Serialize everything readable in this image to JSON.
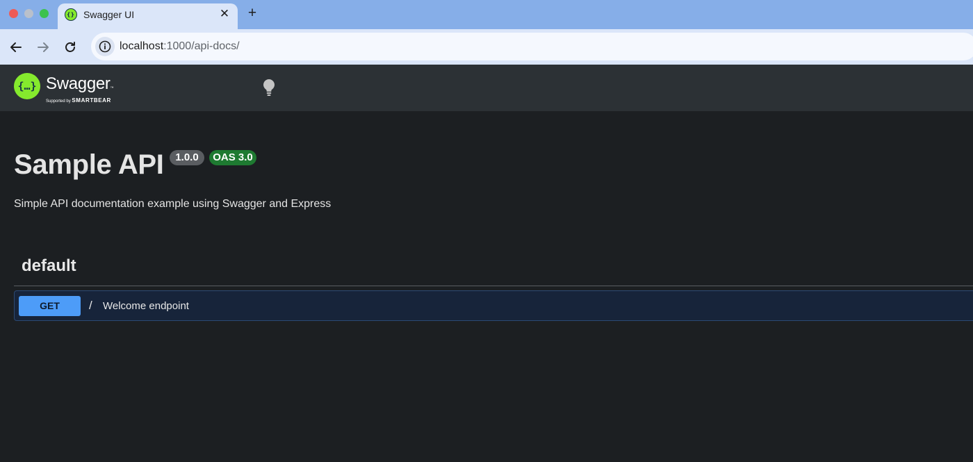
{
  "browser": {
    "tab": {
      "title": "Swagger UI"
    },
    "url": {
      "host": "localhost",
      "path": ":1000/api-docs/"
    }
  },
  "topbar": {
    "logo_text": "Swagger",
    "logo_tm": "™",
    "logo_supported_by": "Supported by",
    "logo_company": "SMARTBEAR"
  },
  "info": {
    "title": "Sample API",
    "version": "1.0.0",
    "oas_version": "OAS 3.0",
    "description": "Simple API documentation example using Swagger and Express"
  },
  "tags": [
    {
      "name": "default",
      "operations": [
        {
          "method": "GET",
          "path": "/",
          "summary": "Welcome endpoint"
        }
      ]
    }
  ],
  "colors": {
    "get_method": "#4d9cf8",
    "get_block_bg": "#17243a",
    "oas_badge": "#1e7a31",
    "version_badge": "#5a5d61",
    "swagger_green": "#85ea2d"
  },
  "icons": {
    "back": "arrow-left-icon",
    "forward": "arrow-right-icon",
    "reload": "reload-icon",
    "site_info": "info-icon",
    "theme": "lightbulb-icon"
  }
}
